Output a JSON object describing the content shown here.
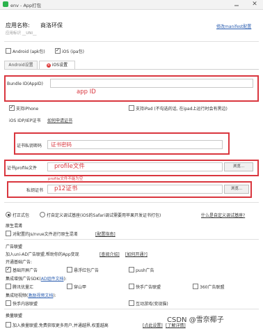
{
  "window": {
    "title": "env - App打包"
  },
  "header": {
    "app_name_label": "应用名称:",
    "app_name_value": "商洛环保",
    "app_id_line": "应用标识 __UNI__",
    "manifest_link": "修改manifest配置"
  },
  "platforms": {
    "android_label": "Android (apk包)",
    "android_checked": false,
    "ios_label": "iOS (ipa包)",
    "ios_checked": true
  },
  "tabs": [
    {
      "label": "Android设置",
      "active": false
    },
    {
      "label": "iOS设置",
      "active": true
    }
  ],
  "ios": {
    "bundle_id_label": "Bundle ID(AppID)",
    "bundle_annotation": "app ID",
    "support_iphone_label": "支持iPhone",
    "support_iphone_checked": true,
    "support_ipad_label": "支持iPad (不勾选的话, 在ipad上运行时会有黑边)",
    "support_ipad_checked": false,
    "cert_section_label": "iOS IDP/IEP证书",
    "cert_section_link": "如何申请证书",
    "cert_password_label": "证书私钥密码",
    "cert_password_annotation": "证书密码",
    "profile_label": "证书profile文件",
    "profile_annotation": "profile文件",
    "browse1": "浏览...",
    "profile_error": "profile文件不能为空",
    "private_cert_label": "私钥证书",
    "private_cert_annotation": "p12证书",
    "browse2": "浏览..."
  },
  "package_type": {
    "formal_label": "打正式包",
    "formal_selected": true,
    "custom_label": "打自定义调试基座(iOS的Safari调试需要用苹果开发证书打包)",
    "custom_selected": false,
    "custom_link": "什么是自定义调试基座?"
  },
  "native_obfuscation": {
    "title": "原生混淆",
    "checkbox_label": "对配置的js/nvue文件进行原生混淆",
    "link": "[配置指南]"
  },
  "ads": {
    "title": "广告联盟",
    "intro": "加入uni-AD广告联盟,帮助你的App变现",
    "intro_link1": "[查阅介绍]",
    "intro_link2": "[如何开通?]",
    "basic_title": "开通基础广告:",
    "basic_items": [
      {
        "label": "基础开屏广告",
        "checked": true
      },
      {
        "label": "悬浮红包广告",
        "checked": false
      },
      {
        "label": "push广告",
        "checked": false
      }
    ],
    "enhanced_title": "集成增强广告SDK(",
    "enhanced_link": "AD组件文档",
    "enhanced_title_end": "):",
    "enhanced_items": [
      {
        "label": "腾讯优量汇",
        "checked": false
      },
      {
        "label": "穿山甲",
        "checked": false
      },
      {
        "label": "快手广告联盟",
        "checked": false
      },
      {
        "label": "360广告联盟",
        "checked": false
      }
    ],
    "video_title": "集成短视频(",
    "video_link": "激励视频文档",
    "video_title_end": "):",
    "video_items": [
      {
        "label": "快手内容联盟",
        "checked": false
      },
      {
        "label": "互动游戏(变现猫)",
        "checked": false
      }
    ]
  },
  "exchange": {
    "title": "换量联盟",
    "checkbox_label": "加入换量联盟,免费获取更多用户,并通越界,权重越高",
    "link1": "[点此设置]",
    "link2": "[了解详情]"
  },
  "watermark": "CSDN @雪奈椰子"
}
